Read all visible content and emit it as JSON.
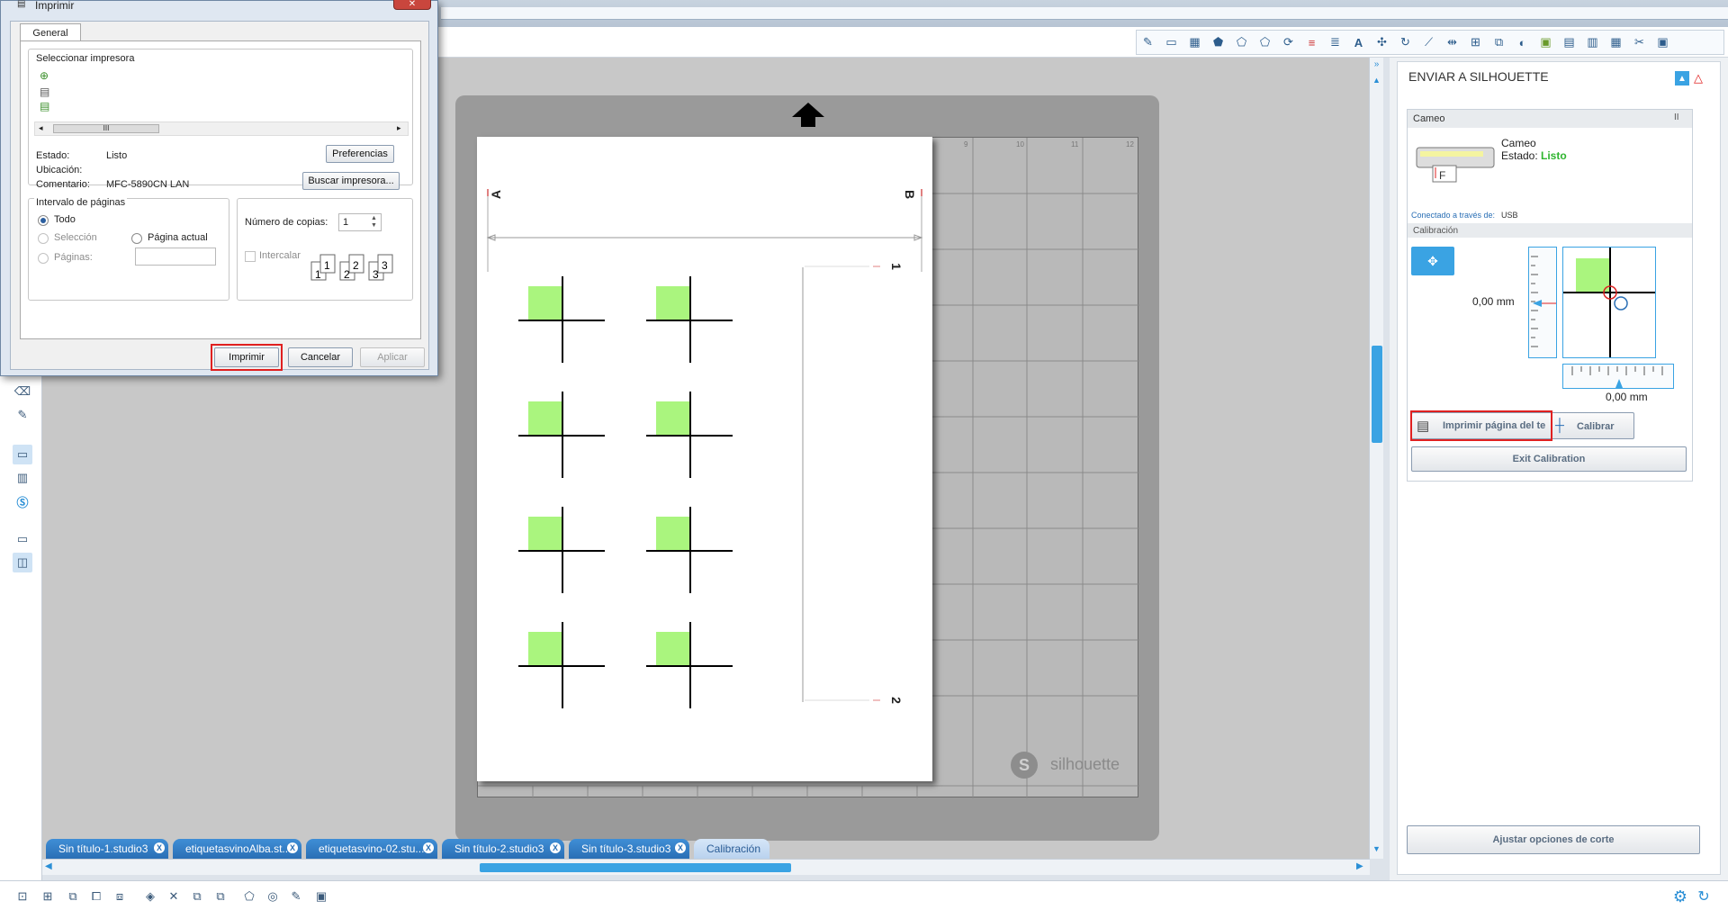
{
  "dialog": {
    "title": "Imprimir",
    "tab": "General",
    "select_printer_label": "Seleccionar impresora",
    "status_label": "Estado:",
    "status_value": "Listo",
    "location_label": "Ubicación:",
    "location_value": "",
    "comment_label": "Comentario:",
    "comment_value": "MFC-5890CN LAN",
    "preferences_button": "Preferencias",
    "find_printer_button": "Buscar impresora...",
    "page_range_label": "Intervalo de páginas",
    "all_label": "Todo",
    "selection_label": "Selección",
    "current_page_label": "Página actual",
    "pages_label": "Páginas:",
    "pages_value": "",
    "copies_label": "Número de copias:",
    "copies_value": "1",
    "collate_label": "Intercalar",
    "print_button": "Imprimir",
    "cancel_button": "Cancelar",
    "apply_button": "Aplicar",
    "scroll_thumb": "III"
  },
  "canvas": {
    "mark_a": "A",
    "mark_b": "B",
    "mark_1": "1",
    "mark_2": "2",
    "ruler_labels": [
      "9",
      "10",
      "11",
      "12"
    ],
    "watermark": "silhouette"
  },
  "tabs": [
    {
      "label": "Sin título-1.studio3",
      "close": "X"
    },
    {
      "label": "etiquetasvinoAlba.st...",
      "close": "X"
    },
    {
      "label": "etiquetasvino-02.stu...",
      "close": "X"
    },
    {
      "label": "Sin título-2.studio3",
      "close": "X"
    },
    {
      "label": "Sin título-3.studio3",
      "close": "X"
    },
    {
      "label": "Calibración",
      "close": ""
    }
  ],
  "panel": {
    "title": "ENVIAR A SILHOUETTE",
    "device_header": "Cameo",
    "device_name": "Cameo",
    "status_label": "Estado:",
    "status_value": "Listo",
    "connected_label": "Conectado a través de:",
    "connected_value": "USB",
    "calibration_section": "Calibración",
    "offset_y": "0,00 mm",
    "offset_x": "0,00 mm",
    "print_test_button": "Imprimir página del te",
    "calibrate_button": "Calibrar",
    "exit_button": "Exit Calibration",
    "adjust_button": "Ajustar opciones de corte",
    "status_color": "#2fb52f"
  },
  "colors": {
    "accent": "#2a6fb5",
    "registration_fill": "#aaf57e",
    "highlight": "#e02020"
  }
}
